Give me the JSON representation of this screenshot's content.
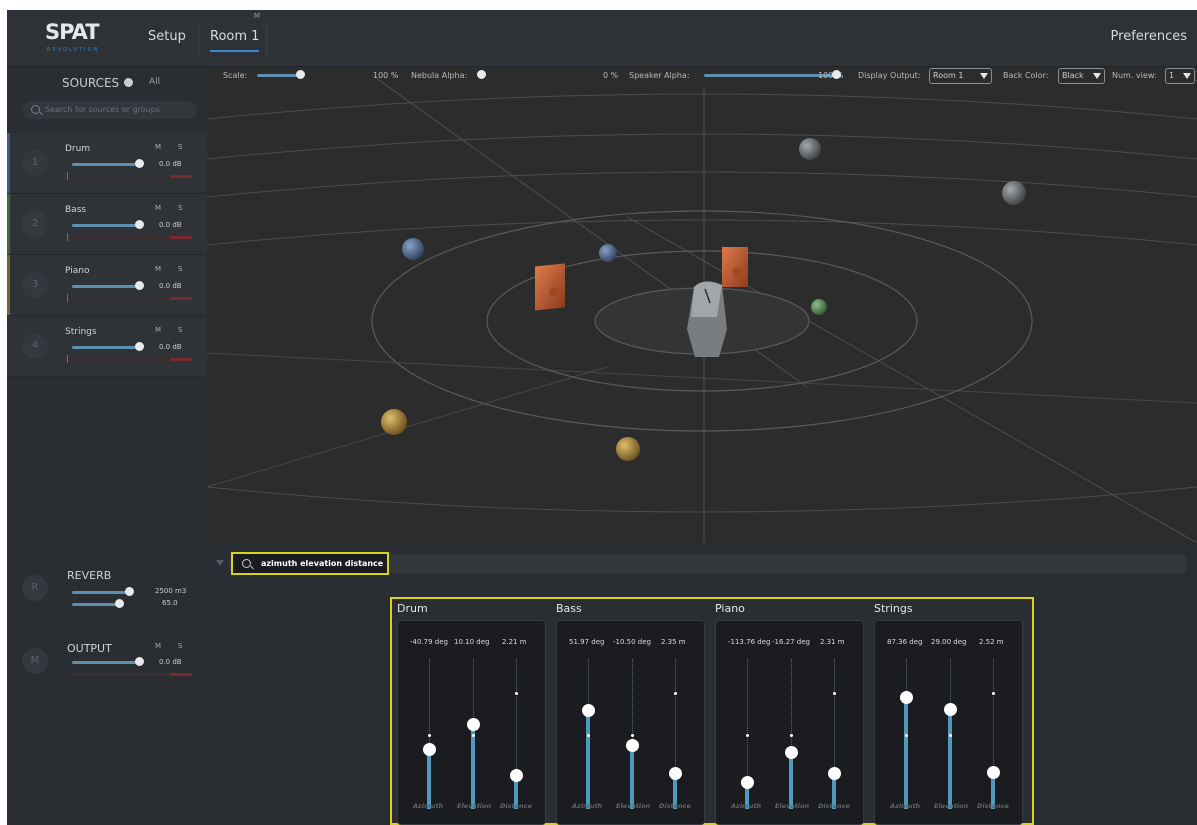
{
  "header": {
    "logo_text": "SPAT",
    "logo_sub": "REVOLUTION",
    "nav_setup": "Setup",
    "nav_room": "Room 1",
    "room_badge": "M",
    "preferences": "Preferences"
  },
  "sidebar": {
    "sources_label": "SOURCES",
    "all_label": "All",
    "search_placeholder": "Search for sources or groups",
    "sources": [
      {
        "num": "1",
        "name": "Drum",
        "mute": "M",
        "solo": "S",
        "gain": "0.0 dB",
        "color": "#3c5c86"
      },
      {
        "num": "2",
        "name": "Bass",
        "mute": "M",
        "solo": "S",
        "gain": "0.0 dB",
        "color": "#3c6a44"
      },
      {
        "num": "3",
        "name": "Piano",
        "mute": "M",
        "solo": "S",
        "gain": "0.0 dB",
        "color": "#7a6330"
      },
      {
        "num": "4",
        "name": "Strings",
        "mute": "M",
        "solo": "S",
        "gain": "0.0 dB",
        "color": "#2f3236"
      }
    ],
    "reverb": {
      "num": "R",
      "name": "REVERB",
      "volume": "2500 m3",
      "value": "65.0"
    },
    "output": {
      "num": "M",
      "name": "OUTPUT",
      "mute": "M",
      "solo": "S",
      "gain": "0.0 dB"
    }
  },
  "viewport": {
    "scale_label": "Scale:",
    "scale_value": "100 %",
    "nebula_label": "Nebula Alpha:",
    "nebula_value": "0 %",
    "speaker_label": "Speaker Alpha:",
    "speaker_value": "100 %",
    "display_output_label": "Display Output:",
    "display_output_value": "Room 1",
    "back_color_label": "Back Color:",
    "back_color_value": "Black",
    "num_view_label": "Num. view:",
    "num_view_value": "1",
    "scale_level": 1.0,
    "nebula_level": 0.0,
    "speaker_level": 1.0
  },
  "filter": {
    "value": "azimuth elevation distance"
  },
  "groups": [
    {
      "name": "Drum",
      "azimuth": "-40.79 deg",
      "elevation": "10.10 deg",
      "distance": "2.21 m",
      "levels": [
        0.4,
        0.57,
        0.23
      ]
    },
    {
      "name": "Bass",
      "azimuth": "51.97 deg",
      "elevation": "-10.50 deg",
      "distance": "2.35 m",
      "levels": [
        0.66,
        0.43,
        0.24
      ]
    },
    {
      "name": "Piano",
      "azimuth": "-113.76 deg",
      "elevation": "-16.27 deg",
      "distance": "2.31 m",
      "levels": [
        0.18,
        0.38,
        0.24
      ]
    },
    {
      "name": "Strings",
      "azimuth": "87.36 deg",
      "elevation": "29.00 deg",
      "distance": "2.52 m",
      "levels": [
        0.75,
        0.67,
        0.25
      ]
    }
  ],
  "param_labels": [
    "Azimuth",
    "Elevation",
    "Distance"
  ]
}
